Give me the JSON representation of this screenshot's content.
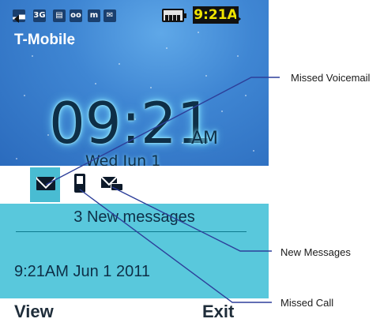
{
  "status_bar": {
    "time": "9:21A",
    "icons": [
      "signal-icon",
      "3g-icon",
      "network-icon",
      "voicemail-status-icon",
      "memory-icon",
      "new-message-status-icon",
      "battery-icon"
    ],
    "icon_glyphs": {
      "signal": "▂▄",
      "g3": "3G",
      "net": "▤",
      "vm": "oo",
      "mem": "m",
      "msg": "✉"
    }
  },
  "carrier": "T-Mobile",
  "clock": {
    "time": "09:21",
    "ampm": "AM",
    "date": "Wed Jun 1"
  },
  "notifications": {
    "icons": [
      "new-message-icon",
      "missed-call-icon",
      "missed-voicemail-icon"
    ],
    "selected": "new-message-icon"
  },
  "message_panel": {
    "title": "3 New messages",
    "datetime": "9:21AM Jun 1 2011"
  },
  "softkeys": {
    "left": "View",
    "right": "Exit"
  },
  "callouts": {
    "missed_voicemail": "Missed Voicemail",
    "new_messages": "New Messages",
    "missed_call": "Missed Call"
  },
  "colors": {
    "wallpaper": "#3f86d3",
    "panel": "#59c8dc",
    "selected_cell": "#49bcd2",
    "status_time_bg": "#111111",
    "status_time_fg": "#f0e400",
    "callout_line": "#2d3f9a"
  }
}
